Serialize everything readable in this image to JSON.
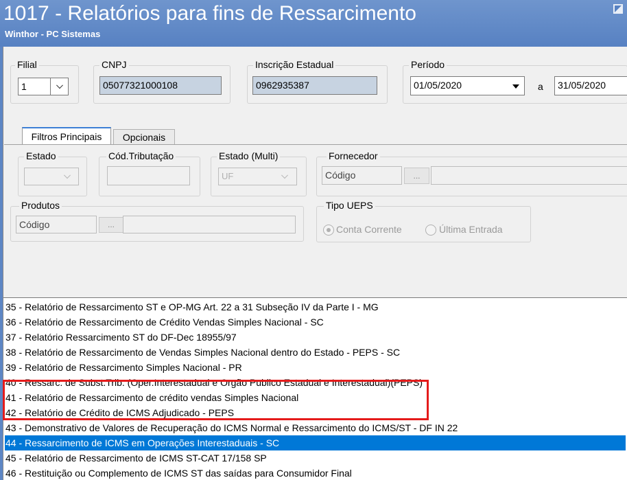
{
  "window": {
    "title": "1017 - Relatórios para fins de Ressarcimento",
    "subtitle": "Winthor - PC Sistemas"
  },
  "header": {
    "filial": {
      "label": "Filial",
      "value": "1"
    },
    "cnpj": {
      "label": "CNPJ",
      "value": "05077321000108"
    },
    "ie": {
      "label": "Inscrição Estadual",
      "value": "0962935387"
    },
    "periodo": {
      "label": "Período",
      "start": "01/05/2020",
      "separator": "a",
      "end": "31/05/2020"
    }
  },
  "tabs": [
    {
      "label": "Filtros Principais",
      "active": true
    },
    {
      "label": "Opcionais",
      "active": false
    }
  ],
  "filters": {
    "estado": {
      "label": "Estado"
    },
    "cod_tributacao": {
      "label": "Cód.Tributação"
    },
    "estado_multi": {
      "label": "Estado (Multi)",
      "value": "UF"
    },
    "fornecedor": {
      "label": "Fornecedor",
      "placeholder": "Código",
      "button": "..."
    },
    "produtos": {
      "label": "Produtos",
      "placeholder": "Código",
      "button": "..."
    },
    "tipo_ueps": {
      "label": "Tipo UEPS",
      "options": [
        {
          "label": "Conta Corrente",
          "selected": true
        },
        {
          "label": "Última Entrada",
          "selected": false
        }
      ]
    }
  },
  "reports": [
    {
      "label": "35 - Relatório de Ressarcimento ST e OP-MG Art. 22 a 31 Subseção IV da Parte I - MG",
      "selected": false
    },
    {
      "label": "36 - Relatório de Ressarcimento de Crédito Vendas Simples Nacional - SC",
      "selected": false
    },
    {
      "label": "37 - Relatório Ressarcimento ST do DF-Dec 18955/97",
      "selected": false
    },
    {
      "label": "38 - Relatório de Ressarcimento de Vendas Simples Nacional dentro do Estado - PEPS - SC",
      "selected": false
    },
    {
      "label": "39 - Relatório de Ressarcimento Simples Nacional - PR",
      "selected": false
    },
    {
      "label": "40 - Ressarc. de Subst.Trib. (Oper.Interestadual e Orgão Publico Estadual e Interestadual)(PEPS)",
      "selected": false
    },
    {
      "label": "41 - Relatório de Ressarcimento de crédito vendas Simples Nacional",
      "selected": false
    },
    {
      "label": "42 - Relatório de Crédito de ICMS Adjudicado - PEPS",
      "selected": false
    },
    {
      "label": "43 - Demonstrativo de Valores de Recuperação do ICMS Normal e Ressarcimento do ICMS/ST - DF IN 22",
      "selected": false
    },
    {
      "label": "44 - Ressarcimento de ICMS em Operações Interestaduais - SC",
      "selected": true
    },
    {
      "label": "45 - Relatório de Ressarcimento de ICMS ST-CAT 17/158 SP",
      "selected": false
    },
    {
      "label": "46 - Restituição ou Complemento de ICMS ST das saídas para Consumidor Final",
      "selected": false
    }
  ],
  "colors": {
    "titlebar": "#5781c2",
    "selection": "#0078d7",
    "highlight": "#e51b1b",
    "readonly_field": "#c7d3e1"
  }
}
